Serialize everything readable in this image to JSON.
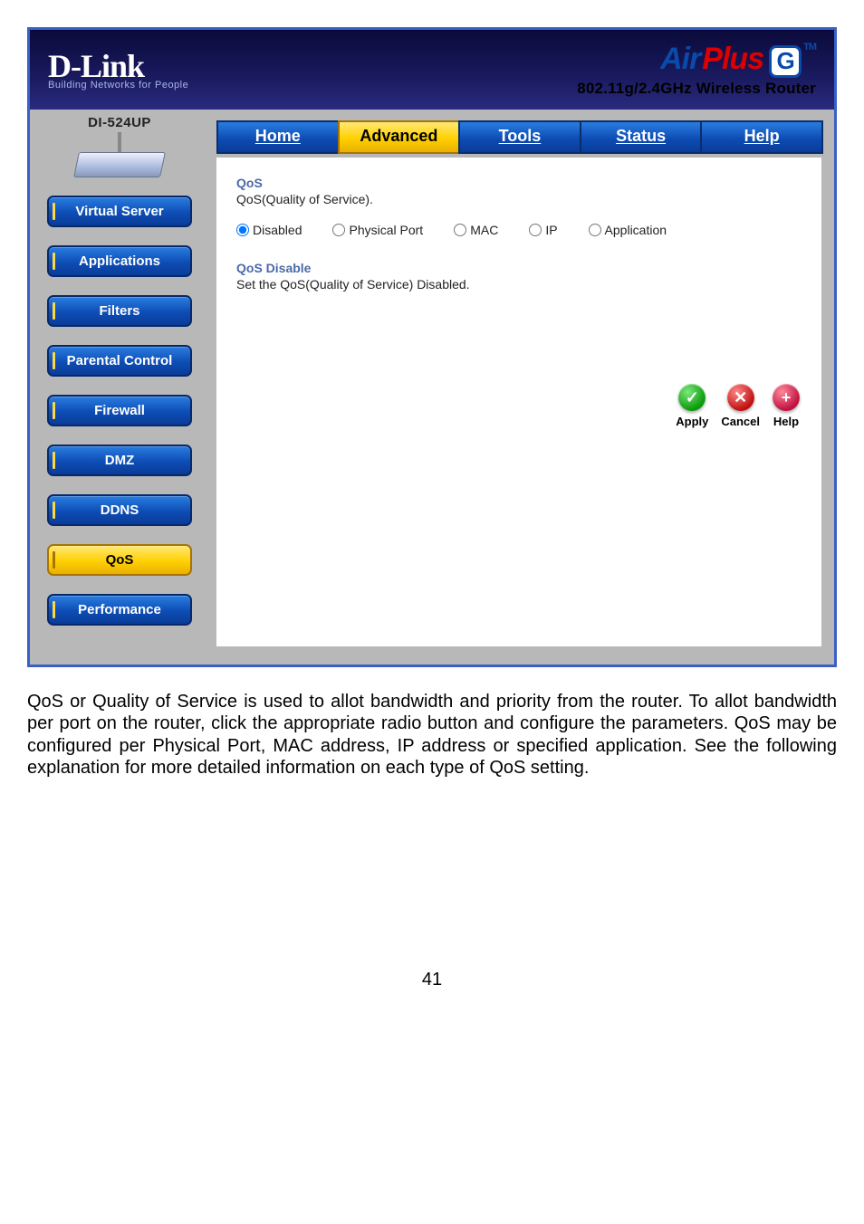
{
  "brand": {
    "name": "D-Link",
    "tagline": "Building Networks for People",
    "product_air": "Air",
    "product_plus": "Plus",
    "product_g": "G",
    "product_tm": "TM",
    "subtitle": "802.11g/2.4GHz Wireless Router"
  },
  "model": "DI-524UP",
  "sidebar": {
    "items": [
      {
        "label": "Virtual Server",
        "active": false
      },
      {
        "label": "Applications",
        "active": false
      },
      {
        "label": "Filters",
        "active": false
      },
      {
        "label": "Parental Control",
        "active": false
      },
      {
        "label": "Firewall",
        "active": false
      },
      {
        "label": "DMZ",
        "active": false
      },
      {
        "label": "DDNS",
        "active": false
      },
      {
        "label": "QoS",
        "active": true
      },
      {
        "label": "Performance",
        "active": false
      }
    ]
  },
  "tabs": [
    {
      "label": "Home",
      "active": false
    },
    {
      "label": "Advanced",
      "active": true
    },
    {
      "label": "Tools",
      "active": false
    },
    {
      "label": "Status",
      "active": false
    },
    {
      "label": "Help",
      "active": false
    }
  ],
  "qos": {
    "title": "QoS",
    "desc": "QoS(Quality of Service).",
    "options": [
      {
        "label": "Disabled",
        "checked": true
      },
      {
        "label": "Physical Port",
        "checked": false
      },
      {
        "label": "MAC",
        "checked": false
      },
      {
        "label": "IP",
        "checked": false
      },
      {
        "label": "Application",
        "checked": false
      }
    ],
    "sub_title": "QoS Disable",
    "sub_desc": "Set the QoS(Quality of Service) Disabled."
  },
  "actions": {
    "apply": "Apply",
    "cancel": "Cancel",
    "help": "Help"
  },
  "icons": {
    "apply_glyph": "✓",
    "cancel_glyph": "✕",
    "help_glyph": "+"
  },
  "document": {
    "paragraph": "QoS or Quality of Service is used to allot bandwidth and priority from the router. To allot bandwidth per port on the router, click the appropriate       radio button and configure the parameters. QoS may be configured per Physical Port, MAC address, IP address or specified application. See the following explanation for more detailed information on each type of QoS setting.",
    "page_number": "41"
  }
}
